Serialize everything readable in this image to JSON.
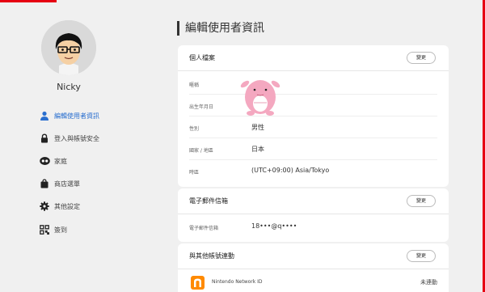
{
  "user": {
    "name": "Nicky"
  },
  "nav": [
    {
      "label": "編輯使用者資訊",
      "icon": "person-icon",
      "active": true
    },
    {
      "label": "登入與帳號安全",
      "icon": "lock-icon",
      "active": false
    },
    {
      "label": "家庭",
      "icon": "family-icon",
      "active": false
    },
    {
      "label": "商店選單",
      "icon": "shopping-bag-icon",
      "active": false
    },
    {
      "label": "其他設定",
      "icon": "gear-icon",
      "active": false
    },
    {
      "label": "簽到",
      "icon": "qr-code-icon",
      "active": false
    }
  ],
  "page_title": "編輯使用者資訊",
  "profile_card": {
    "title": "個人檔案",
    "edit_label": "變更",
    "rows": [
      {
        "label": "暱稱",
        "value": ""
      },
      {
        "label": "出生年月日",
        "value": ""
      },
      {
        "label": "性別",
        "value": "男性"
      },
      {
        "label": "國家 / 地區",
        "value": "日本"
      },
      {
        "label": "時區",
        "value": "(UTC+09:00) Asia/Tokyo"
      }
    ]
  },
  "email_card": {
    "title": "電子郵件信箱",
    "edit_label": "變更",
    "rows": [
      {
        "label": "電子郵件信箱",
        "value": "18•••@q••••"
      }
    ]
  },
  "linked_card": {
    "title": "與其他帳號連動",
    "edit_label": "變更",
    "service": "Nintendo Network ID",
    "status": "未連動"
  },
  "colors": {
    "accent": "#e60012",
    "active_nav": "#2a6fcf",
    "nnid_orange": "#ff8a00"
  }
}
